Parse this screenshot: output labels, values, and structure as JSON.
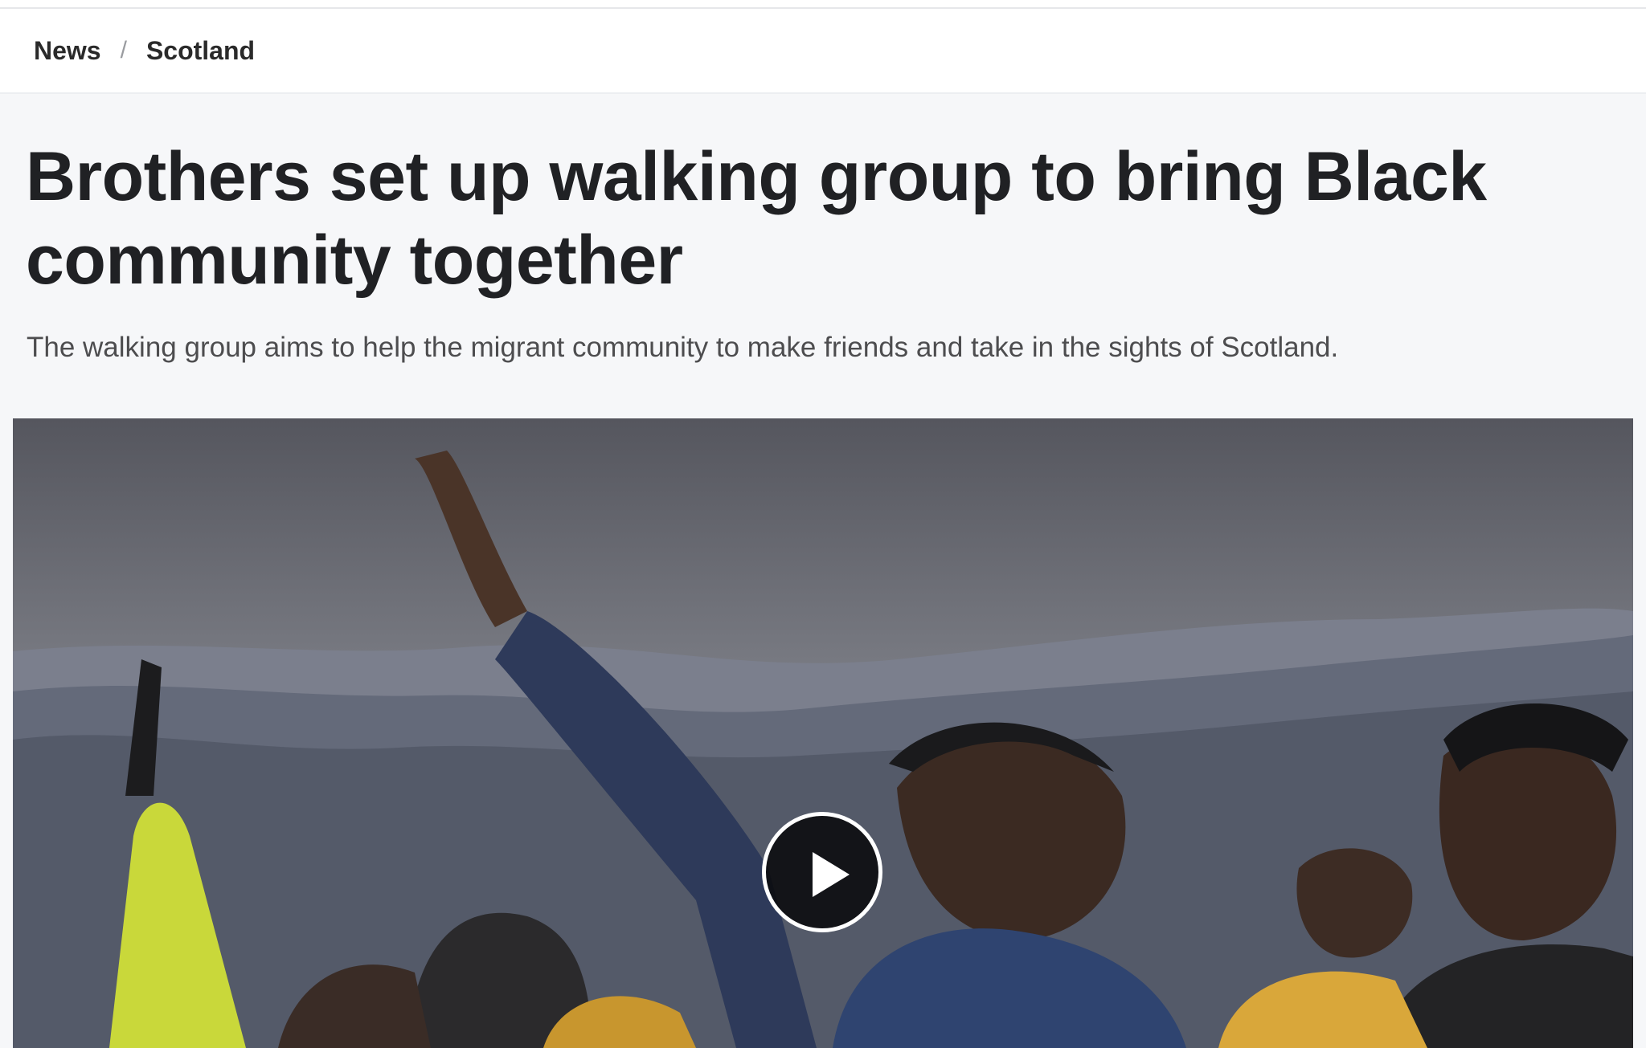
{
  "breadcrumb": {
    "items": [
      {
        "label": "News"
      },
      {
        "label": "Scotland"
      }
    ],
    "separator": "/"
  },
  "article": {
    "headline": "Brothers set up walking group to bring Black community together",
    "summary": "The walking group aims to help the migrant community to make friends and take in the sights of Scotland."
  },
  "media": {
    "type": "video",
    "play_icon": "play-icon"
  },
  "colors": {
    "background": "#f6f7f9",
    "text": "#202124",
    "summary_text": "#4d4d4f"
  }
}
